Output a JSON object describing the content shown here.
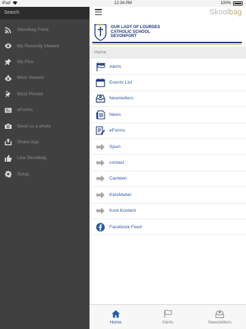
{
  "status_bar": {
    "carrier": "iPad",
    "time": "12:34 PM",
    "battery": "100%"
  },
  "sidebar": {
    "search_label": "Search",
    "items": [
      {
        "label": "Skoolbag Feed",
        "icon": "rss-icon"
      },
      {
        "label": "My Recently Viewed",
        "icon": "eye-icon"
      },
      {
        "label": "My Pins",
        "icon": "pin-icon"
      },
      {
        "label": "Most Viewed",
        "icon": "eye-star-icon"
      },
      {
        "label": "Most Pinned",
        "icon": "pin-star-icon"
      },
      {
        "label": "eForms",
        "icon": "form-icon"
      },
      {
        "label": "Send us a photo",
        "icon": "camera-icon"
      },
      {
        "label": "Share App",
        "icon": "share-icon"
      },
      {
        "label": "Like Skoolbag",
        "icon": "like-icon"
      },
      {
        "label": "Setup",
        "icon": "gear-icon"
      }
    ]
  },
  "header": {
    "brand_main": "Skool",
    "brand_accent": "bag",
    "school_line1": "OUR LADY OF LOURDES",
    "school_line2": "CATHOLIC SCHOOL",
    "school_line3": "DEVONPORT"
  },
  "breadcrumb": "Home",
  "list": [
    {
      "label": "Alerts",
      "icon": "flag-icon"
    },
    {
      "label": "Events List",
      "icon": "calendar-icon"
    },
    {
      "label": "Newsletters",
      "icon": "inbox-icon"
    },
    {
      "label": "News",
      "icon": "news-icon"
    },
    {
      "label": "eForms",
      "icon": "eform-icon"
    },
    {
      "label": "Sport",
      "icon": "arrow-right-icon"
    },
    {
      "label": "contact",
      "icon": "arrow-right-icon"
    },
    {
      "label": "Canteen",
      "icon": "arrow-right-icon"
    },
    {
      "label": "KidsMatter",
      "icon": "arrow-right-icon"
    },
    {
      "label": "Kool Kontent",
      "icon": "arrow-right-icon"
    },
    {
      "label": "Facebook Feed",
      "icon": "facebook-icon"
    }
  ],
  "tabs": [
    {
      "label": "Home",
      "icon": "home-icon",
      "active": true
    },
    {
      "label": "Alerts",
      "icon": "flag-icon",
      "active": false
    },
    {
      "label": "Newsletters",
      "icon": "inbox-icon",
      "active": false
    }
  ],
  "colors": {
    "accent": "#2a5aa6",
    "school_blue": "#1d3b82",
    "gold": "#c9a860",
    "sidebar_bg": "#404040"
  }
}
